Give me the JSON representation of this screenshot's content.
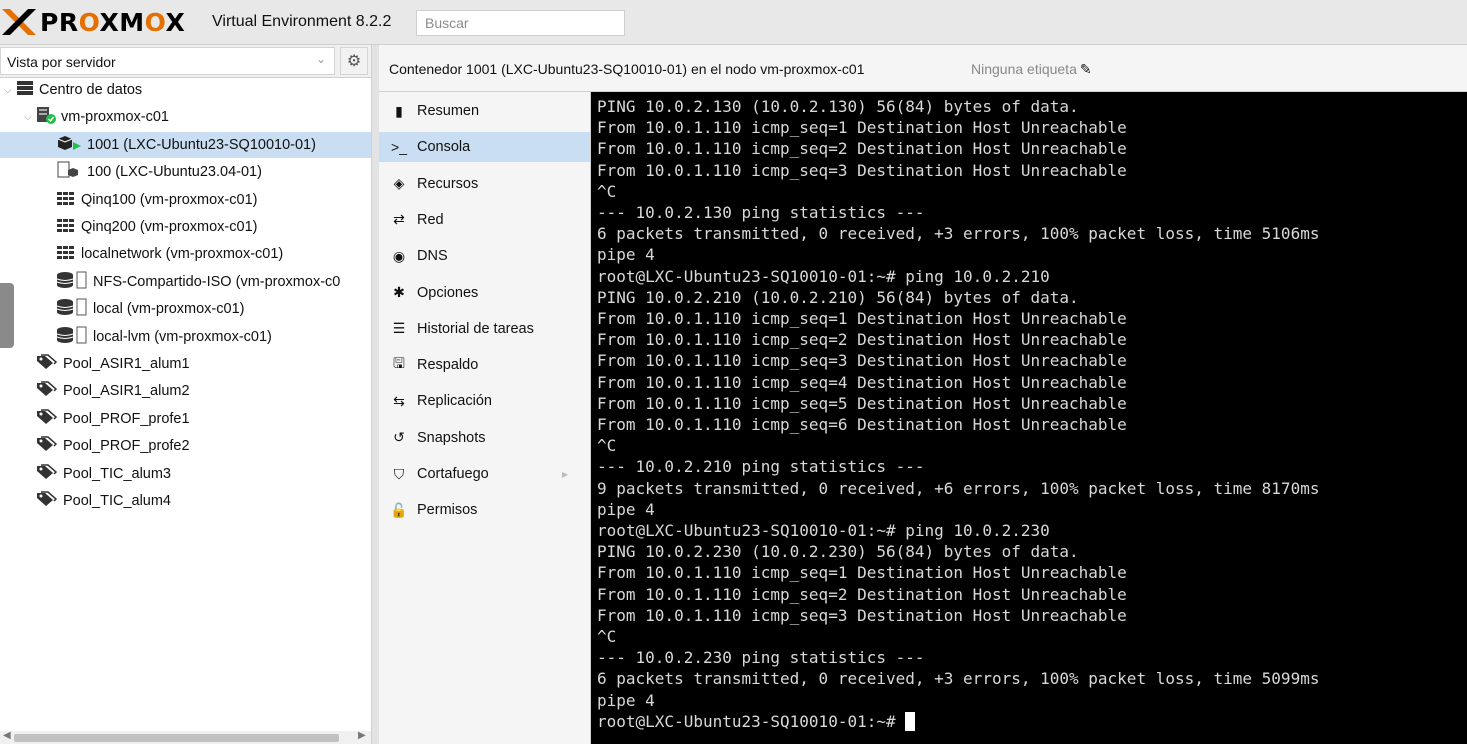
{
  "header": {
    "logo_text": "PROXMOX",
    "product": "Virtual Environment 8.2.2",
    "search_placeholder": "Buscar"
  },
  "left": {
    "view_label": "Vista por servidor",
    "tree": [
      {
        "label": "Centro de datos",
        "icon": "datacenter-icon"
      },
      {
        "label": "vm-proxmox-c01",
        "icon": "node-online-icon"
      },
      {
        "label": "1001 (LXC-Ubuntu23-SQ10010-01)",
        "icon": "container-running-icon"
      },
      {
        "label": "100 (LXC-Ubuntu23.04-01)",
        "icon": "container-template-icon"
      },
      {
        "label": "Qinq100 (vm-proxmox-c01)",
        "icon": "network-icon"
      },
      {
        "label": "Qinq200 (vm-proxmox-c01)",
        "icon": "network-icon"
      },
      {
        "label": "localnetwork (vm-proxmox-c01)",
        "icon": "network-icon"
      },
      {
        "label": "NFS-Compartido-ISO (vm-proxmox-c0",
        "icon": "storage-icon"
      },
      {
        "label": "local (vm-proxmox-c01)",
        "icon": "storage-icon"
      },
      {
        "label": "local-lvm (vm-proxmox-c01)",
        "icon": "storage-icon"
      },
      {
        "label": "Pool_ASIR1_alum1",
        "icon": "pool-tags-icon"
      },
      {
        "label": "Pool_ASIR1_alum2",
        "icon": "pool-tags-icon"
      },
      {
        "label": "Pool_PROF_profe1",
        "icon": "pool-tags-icon"
      },
      {
        "label": "Pool_PROF_profe2",
        "icon": "pool-tags-icon"
      },
      {
        "label": "Pool_TIC_alum3",
        "icon": "pool-tags-icon"
      },
      {
        "label": "Pool_TIC_alum4",
        "icon": "pool-tags-icon"
      }
    ]
  },
  "content": {
    "title": "Contenedor 1001 (LXC-Ubuntu23-SQ10010-01) en el nodo vm-proxmox-c01",
    "tags": "Ninguna etiqueta"
  },
  "menu": [
    {
      "label": "Resumen",
      "icon": "book-icon",
      "glyph": "▮"
    },
    {
      "label": "Consola",
      "icon": "terminal-icon",
      "glyph": ">_"
    },
    {
      "label": "Recursos",
      "icon": "cube-icon",
      "glyph": "◈"
    },
    {
      "label": "Red",
      "icon": "exchange-icon",
      "glyph": "⇄"
    },
    {
      "label": "DNS",
      "icon": "globe-icon",
      "glyph": "◉"
    },
    {
      "label": "Opciones",
      "icon": "gear-icon",
      "glyph": "✱"
    },
    {
      "label": "Historial de tareas",
      "icon": "list-icon",
      "glyph": "☰"
    },
    {
      "label": "Respaldo",
      "icon": "floppy-icon",
      "glyph": "🖫"
    },
    {
      "label": "Replicación",
      "icon": "retweet-icon",
      "glyph": "⇆"
    },
    {
      "label": "Snapshots",
      "icon": "history-icon",
      "glyph": "↺"
    },
    {
      "label": "Cortafuego",
      "icon": "shield-icon",
      "glyph": "⛉"
    },
    {
      "label": "Permisos",
      "icon": "unlock-icon",
      "glyph": "🔓"
    }
  ],
  "terminal": {
    "lines": [
      "PING 10.0.2.130 (10.0.2.130) 56(84) bytes of data.",
      "From 10.0.1.110 icmp_seq=1 Destination Host Unreachable",
      "From 10.0.1.110 icmp_seq=2 Destination Host Unreachable",
      "From 10.0.1.110 icmp_seq=3 Destination Host Unreachable",
      "^C",
      "--- 10.0.2.130 ping statistics ---",
      "6 packets transmitted, 0 received, +3 errors, 100% packet loss, time 5106ms",
      "pipe 4",
      "root@LXC-Ubuntu23-SQ10010-01:~# ping 10.0.2.210",
      "PING 10.0.2.210 (10.0.2.210) 56(84) bytes of data.",
      "From 10.0.1.110 icmp_seq=1 Destination Host Unreachable",
      "From 10.0.1.110 icmp_seq=2 Destination Host Unreachable",
      "From 10.0.1.110 icmp_seq=3 Destination Host Unreachable",
      "From 10.0.1.110 icmp_seq=4 Destination Host Unreachable",
      "From 10.0.1.110 icmp_seq=5 Destination Host Unreachable",
      "From 10.0.1.110 icmp_seq=6 Destination Host Unreachable",
      "^C",
      "--- 10.0.2.210 ping statistics ---",
      "9 packets transmitted, 0 received, +6 errors, 100% packet loss, time 8170ms",
      "pipe 4",
      "root@LXC-Ubuntu23-SQ10010-01:~# ping 10.0.2.230",
      "PING 10.0.2.230 (10.0.2.230) 56(84) bytes of data.",
      "From 10.0.1.110 icmp_seq=1 Destination Host Unreachable",
      "From 10.0.1.110 icmp_seq=2 Destination Host Unreachable",
      "From 10.0.1.110 icmp_seq=3 Destination Host Unreachable",
      "^C",
      "--- 10.0.2.230 ping statistics ---",
      "6 packets transmitted, 0 received, +3 errors, 100% packet loss, time 5099ms",
      "pipe 4"
    ],
    "prompt": "root@LXC-Ubuntu23-SQ10010-01:~# "
  },
  "colors": {
    "accent": "#e57000",
    "selection": "#c9def2",
    "running": "#21bf4b"
  }
}
